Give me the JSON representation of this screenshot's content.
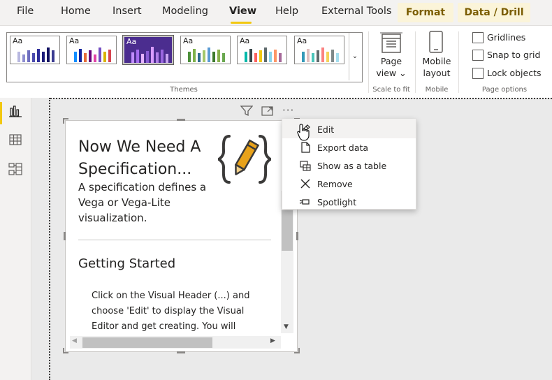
{
  "menubar": {
    "items": [
      "File",
      "Home",
      "Insert",
      "Modeling",
      "View",
      "Help",
      "External Tools"
    ],
    "active": "View",
    "contextual_tabs": [
      "Format",
      "Data / Drill"
    ]
  },
  "ribbon": {
    "themes_label": "Themes",
    "theme_swatch_text": "Aa",
    "page_view": {
      "line1": "Page",
      "line2": "view",
      "caret": "⌄"
    },
    "scale_to_fit_label": "Scale to fit",
    "mobile_layout": {
      "line1": "Mobile",
      "line2": "layout"
    },
    "mobile_label": "Mobile",
    "page_options": {
      "label": "Page options",
      "gridlines": "Gridlines",
      "snap_to_grid": "Snap to grid",
      "lock_objects": "Lock objects"
    }
  },
  "visual": {
    "title": "Now We Need A Specification...",
    "description": "A specification defines a Vega or Vega-Lite visualization.",
    "heading": "Getting Started",
    "body": "Click on the Visual Header (...) and choose 'Edit' to display the Visual Editor and get creating. You will also",
    "header_more": "···"
  },
  "context_menu": {
    "items": [
      {
        "label": "Edit",
        "icon": "pencil-icon"
      },
      {
        "label": "Export data",
        "icon": "export-icon"
      },
      {
        "label": "Show as a table",
        "icon": "table-view-icon"
      },
      {
        "label": "Remove",
        "icon": "close-icon"
      },
      {
        "label": "Spotlight",
        "icon": "spotlight-icon"
      }
    ]
  },
  "colors": {
    "accent_yellow": "#f2c811",
    "contextual_tab_bg": "#fbf4d9",
    "logo_orange": "#e8a21a",
    "selected_theme_bg": "#4b2d8f"
  }
}
